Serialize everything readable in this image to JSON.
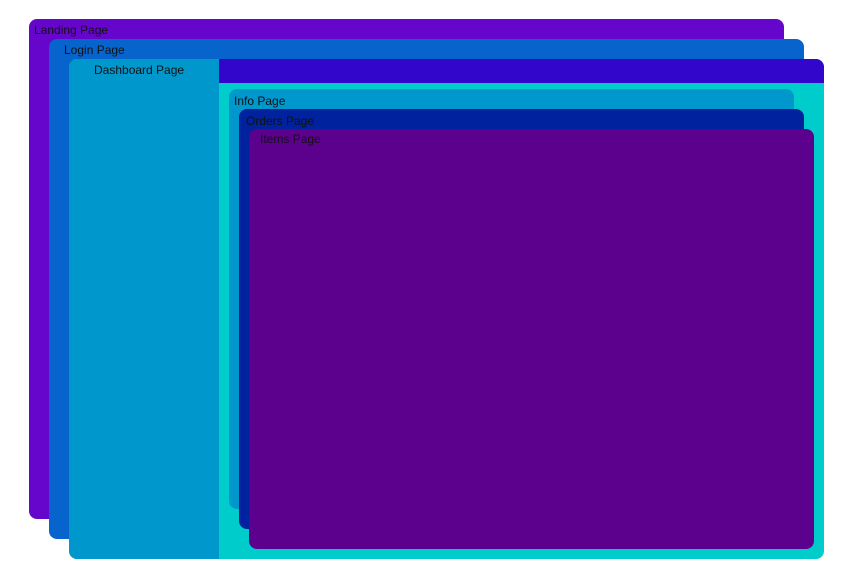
{
  "diagram": {
    "pages": {
      "landing": {
        "label": "Landing Page",
        "color": "#6606cc"
      },
      "login": {
        "label": "Login Page",
        "color": "#0664cc"
      },
      "dashboard": {
        "label": "Dashboard Page",
        "color": "#00cccc",
        "sidebar_color": "#0097cc",
        "topbar_color": "#3306cc"
      },
      "info": {
        "label": "Info Page",
        "color": "#0097cc"
      },
      "orders": {
        "label": "Orders Page",
        "color": "#00229e"
      },
      "items": {
        "label": "Items Page",
        "color": "#5c008e"
      }
    }
  }
}
